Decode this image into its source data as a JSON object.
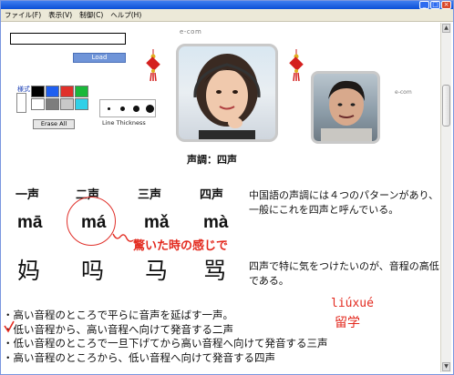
{
  "window": {
    "menu": [
      "ファイル(F)",
      "表示(V)",
      "制御(C)",
      "ヘルプ(H)"
    ]
  },
  "toolbar": {
    "load_label": "Load",
    "color_label": "様式",
    "erase_label": "Erase All",
    "thickness_label": "Line Thickness",
    "palette_colors": [
      "#000000",
      "#1f5ff0",
      "#e0302a",
      "#19b83a",
      "#ffffff",
      "#7d7d7d",
      "#c8c8c8",
      "#30d0e8"
    ]
  },
  "brand": {
    "top": "e-com",
    "right": "e-com"
  },
  "lesson": {
    "caption": "声調：四声",
    "tones": [
      {
        "name": "一声",
        "pinyin": "mā",
        "hanzi": "妈"
      },
      {
        "name": "二声",
        "pinyin": "má",
        "hanzi": "吗"
      },
      {
        "name": "三声",
        "pinyin": "mǎ",
        "hanzi": "马"
      },
      {
        "name": "四声",
        "pinyin": "mà",
        "hanzi": "骂"
      }
    ],
    "annotation": "驚いた時の感じで",
    "para1": "中国語の声調には４つのパターンがあり、一般にこれを四声と呼んでいる。",
    "para2": "四声で特に気をつけたいのが、音程の高低である。",
    "liuxue_pinyin": "liúxué",
    "liuxue_hanzi": "留学",
    "bullets": [
      "・高い音程のところで平らに音声を延ばす一声。",
      "・低い音程から、高い音程へ向けて発音する二声",
      "・低い音程のところで一旦下げてから高い音程へ向けて発音する三声",
      "・高い音程のところから、低い音程へ向けて発音する四声"
    ]
  },
  "colors": {
    "accent_red": "#e32a1f",
    "title_blue": "#0a4fd6"
  }
}
